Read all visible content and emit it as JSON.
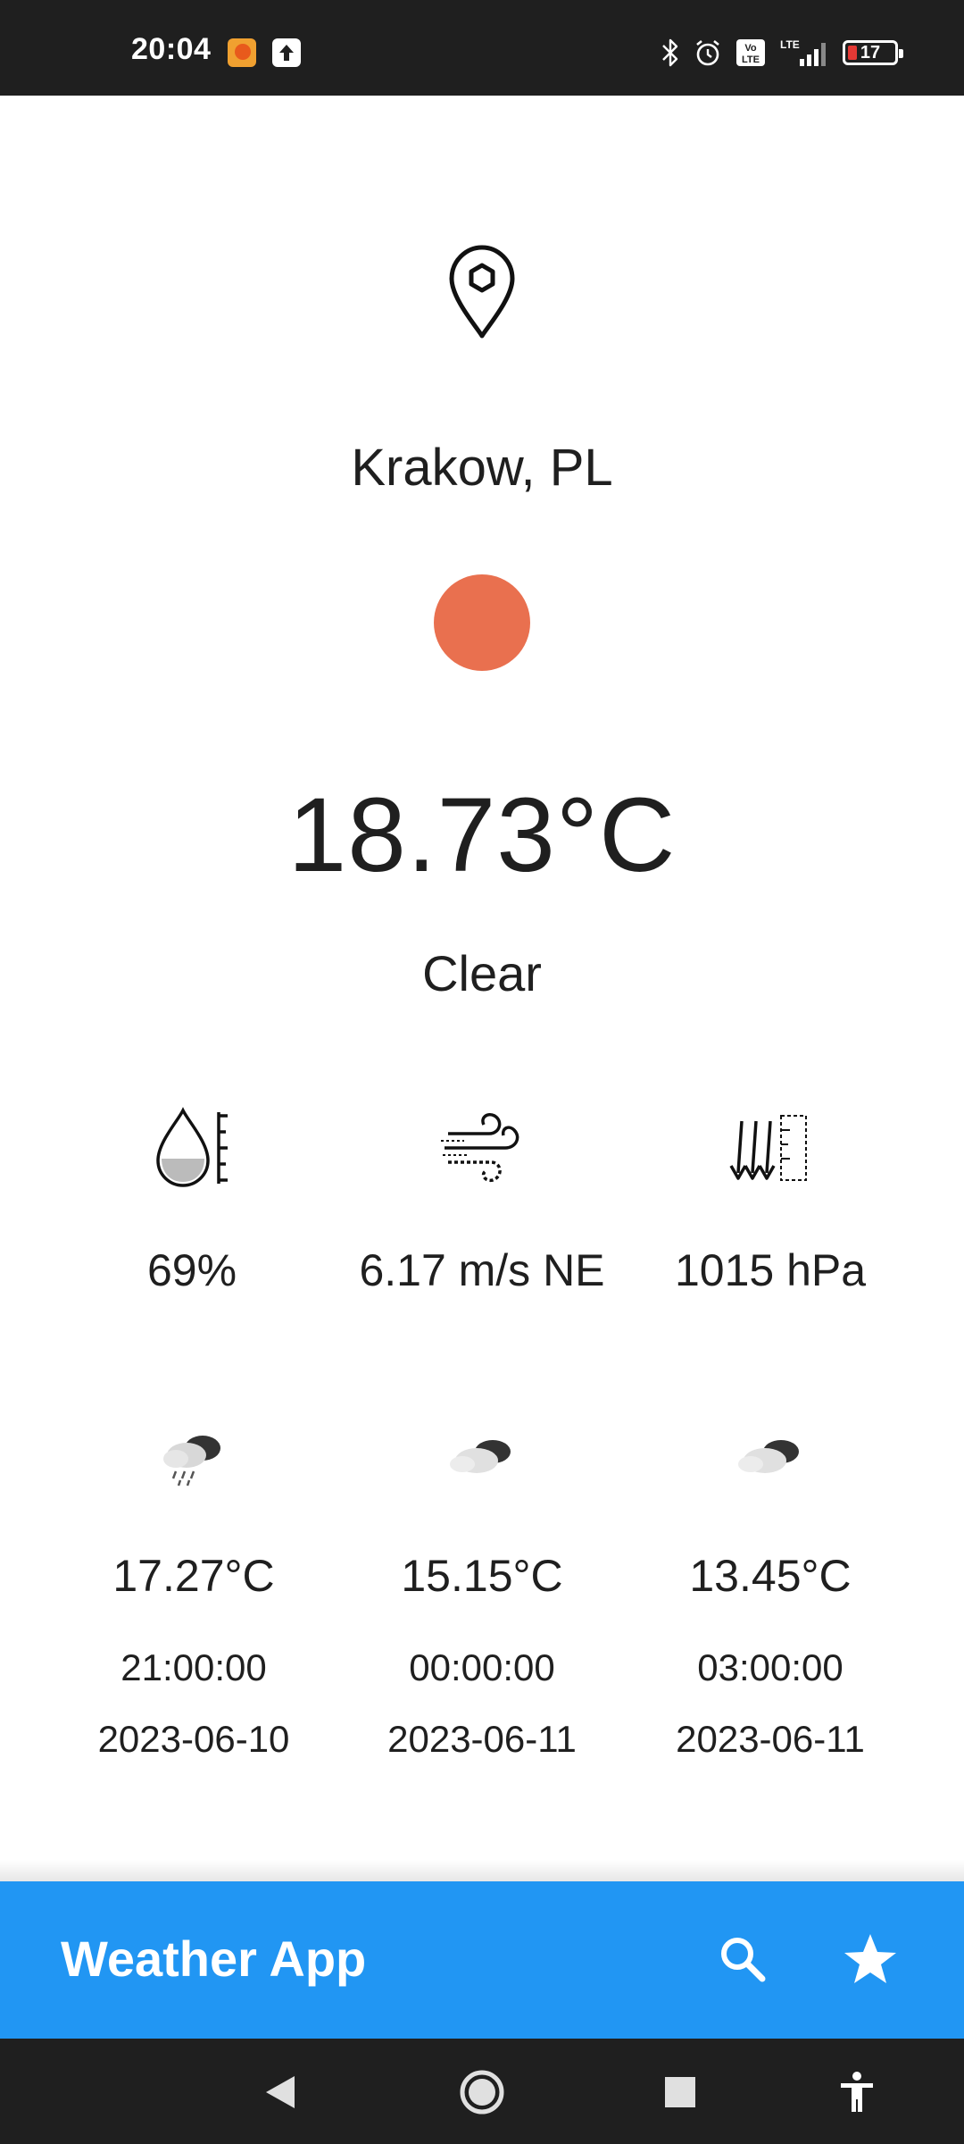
{
  "status_bar": {
    "time": "20:04",
    "battery": "17",
    "network": "LTE",
    "volte": "Vo LTE"
  },
  "location": {
    "name": "Krakow, PL"
  },
  "current": {
    "temperature": "18.73°C",
    "condition": "Clear",
    "condition_color": "#e9704f"
  },
  "stats": [
    {
      "icon": "humidity-icon",
      "value": "69%"
    },
    {
      "icon": "wind-icon",
      "value": "6.17 m/s NE"
    },
    {
      "icon": "pressure-icon",
      "value": "1015 hPa"
    }
  ],
  "forecast": [
    {
      "icon": "rain-cloud-icon",
      "temp": "17.27°C",
      "time": "21:00:00",
      "date": "2023-06-10"
    },
    {
      "icon": "cloudy-icon",
      "temp": "15.15°C",
      "time": "00:00:00",
      "date": "2023-06-11"
    },
    {
      "icon": "cloudy-icon",
      "temp": "13.45°C",
      "time": "03:00:00",
      "date": "2023-06-11"
    }
  ],
  "app_bar": {
    "title": "Weather App",
    "color": "#2196f3",
    "actions": [
      "search-icon",
      "star-icon"
    ]
  }
}
